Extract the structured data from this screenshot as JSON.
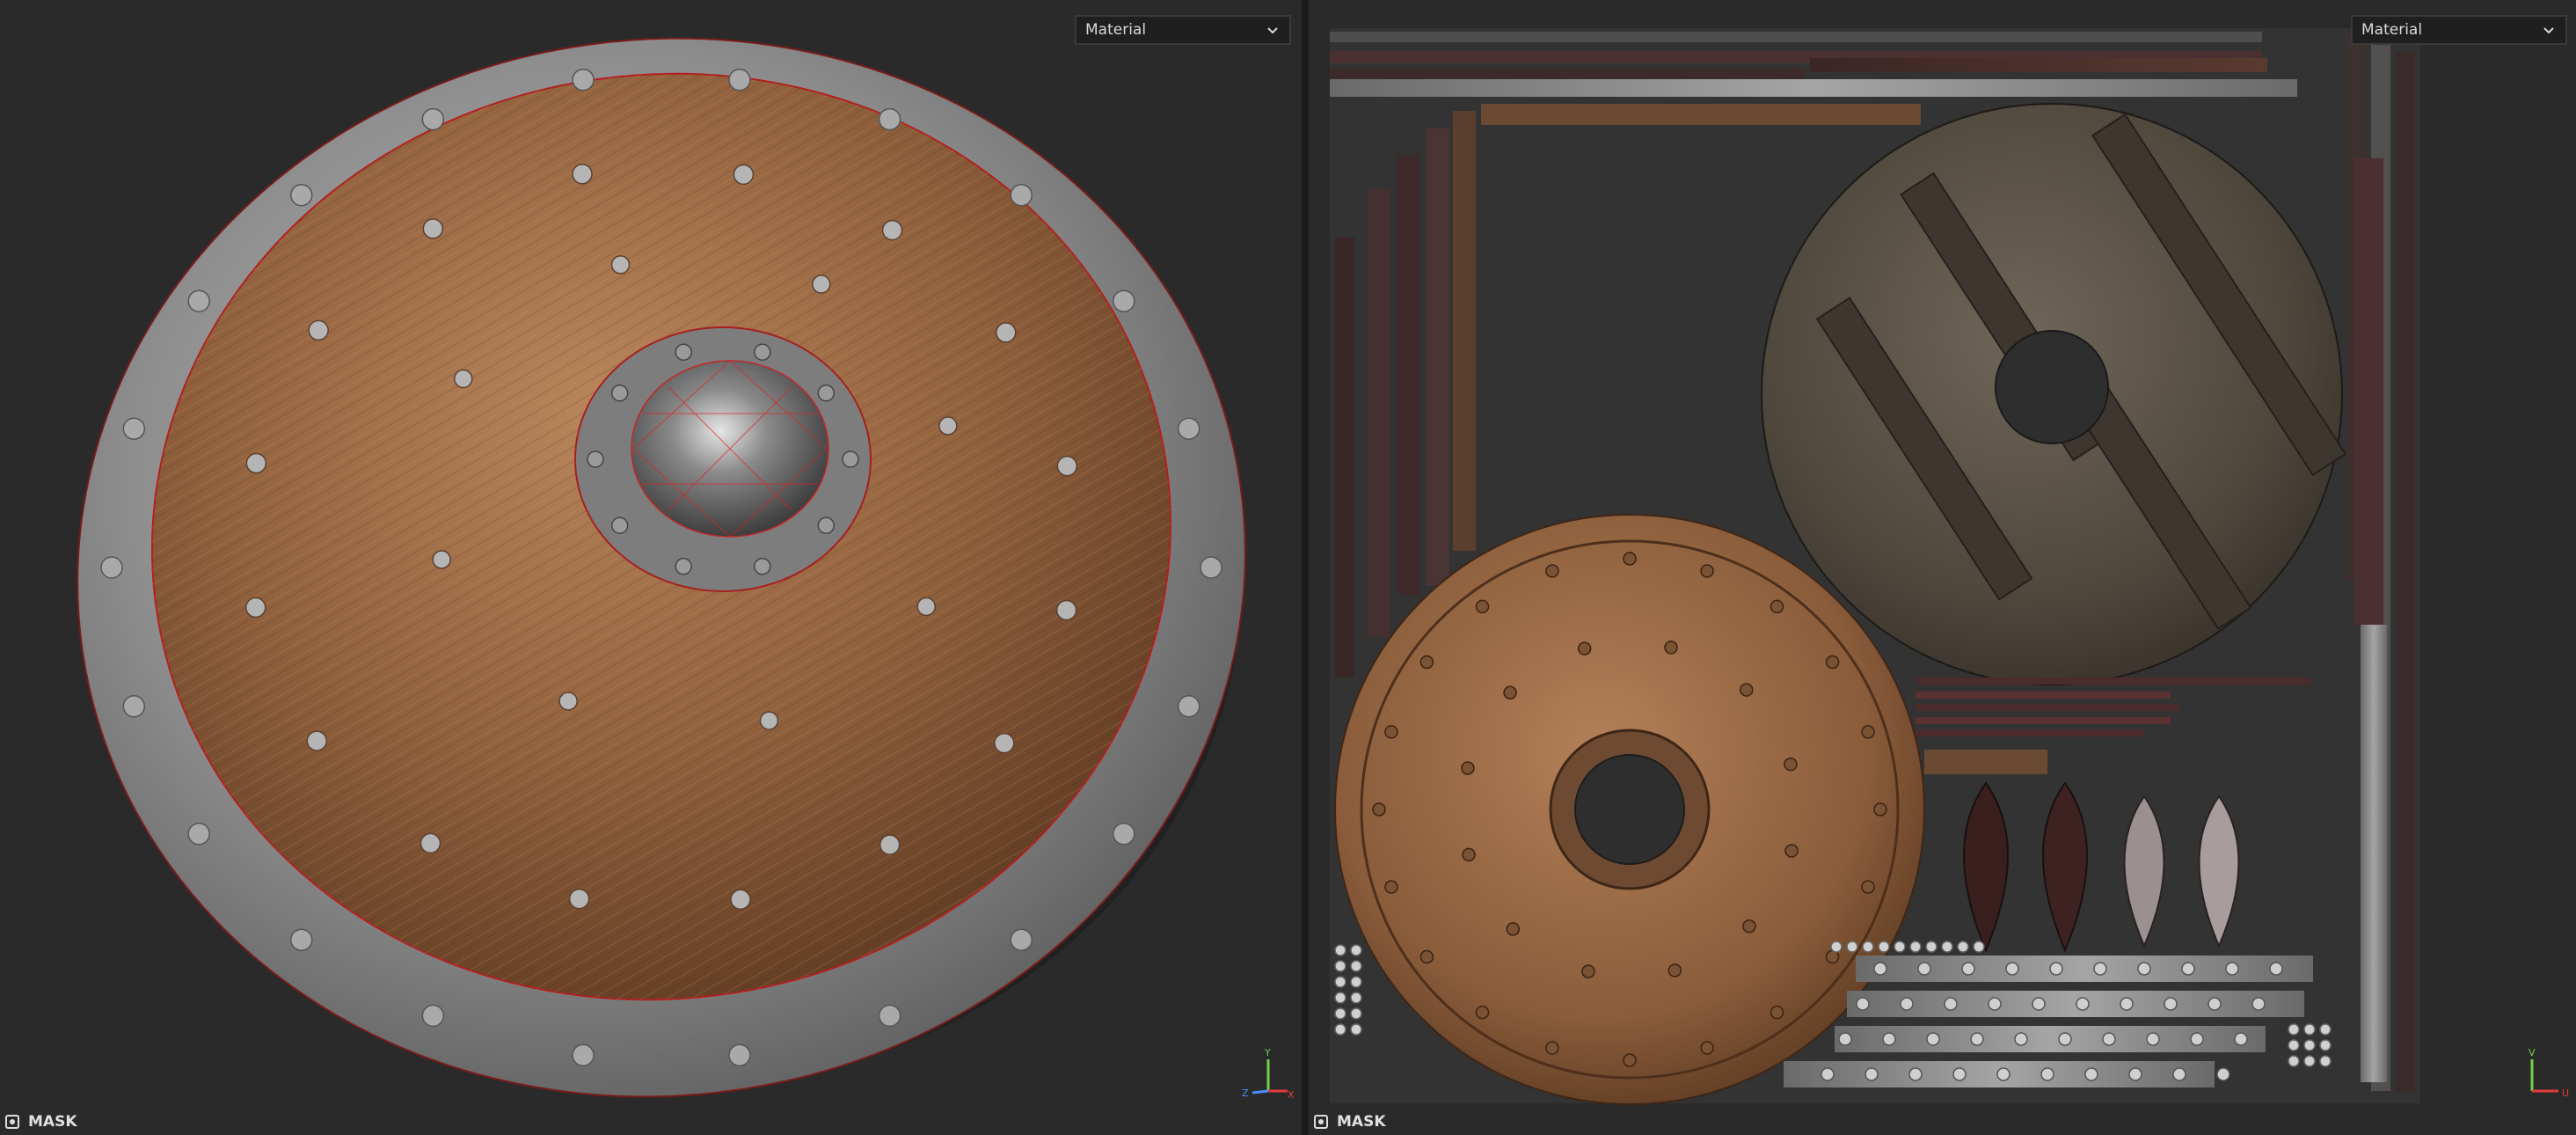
{
  "viewport_3d": {
    "shading_mode": "Material",
    "mask_label": "MASK",
    "axes": {
      "y": "Y",
      "z": "Z",
      "x": "X"
    }
  },
  "viewport_2d": {
    "shading_mode": "Material",
    "mask_label": "MASK",
    "axes": {
      "v": "V",
      "u": "U"
    }
  },
  "icons": {
    "dropdown": "chevron-down-icon",
    "mask": "mask-toggle-icon",
    "gizmo": "axis-gizmo-icon"
  },
  "colors": {
    "background": "#2a2a2a",
    "wood": "#9a6a45",
    "metal": "#8c8c8c",
    "wireframe": "#e02020",
    "axis_x": "#e23b3b",
    "axis_y": "#6fd24a",
    "axis_z": "#4a8cff"
  }
}
